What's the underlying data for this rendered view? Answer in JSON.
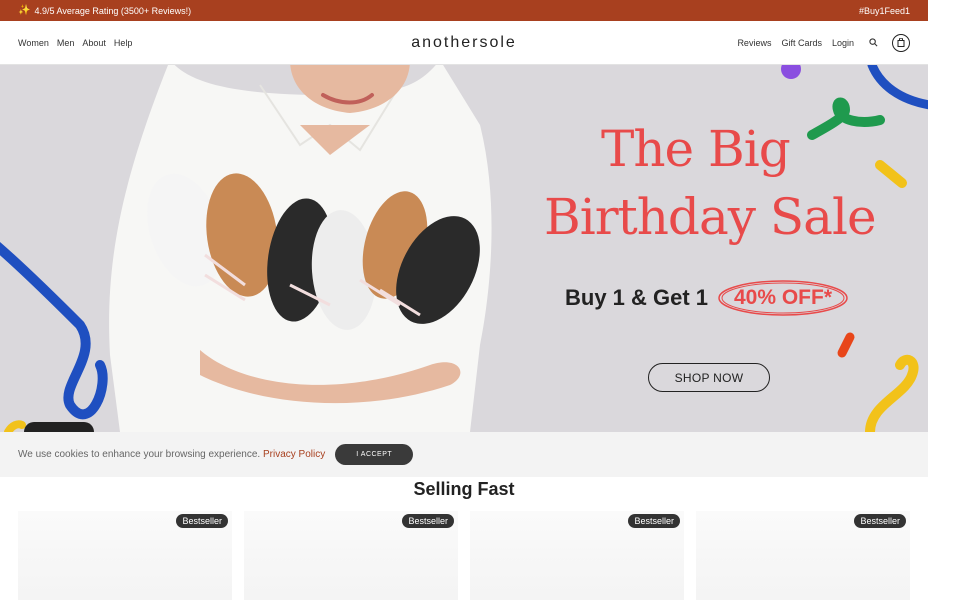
{
  "announcement": {
    "left_icon": "sparkle-icon",
    "rating_text": "4.9/5 Average Rating (3500+ Reviews!)",
    "hashtag": "#Buy1Feed1"
  },
  "header": {
    "logo": "anothersole",
    "nav_left": [
      "Women",
      "Men",
      "About",
      "Help"
    ],
    "nav_right": [
      "Reviews",
      "Gift Cards",
      "Login"
    ],
    "search_icon": "search-icon",
    "cart_icon": "shopping-bag-icon"
  },
  "hero": {
    "title_line1": "The Big",
    "title_line2": "Birthday Sale",
    "offer": "Buy 1 & Get 1",
    "discount": "40% OFF*",
    "cta": "SHOP NOW",
    "colors": {
      "background": "#dad8dc",
      "title": "#e84a4a",
      "blue": "#1f4fc0",
      "green": "#1f9a4e",
      "yellow": "#f2c21a",
      "purple": "#8a4ee0"
    }
  },
  "cookie_banner": {
    "message": "We use cookies to enhance your browsing experience.",
    "link": "Privacy Policy",
    "accept": "I ACCEPT"
  },
  "selling_fast": {
    "title": "Selling Fast",
    "products": [
      {
        "badge": "Bestseller"
      },
      {
        "badge": "Bestseller"
      },
      {
        "badge": "Bestseller"
      },
      {
        "badge": "Bestseller"
      }
    ]
  }
}
